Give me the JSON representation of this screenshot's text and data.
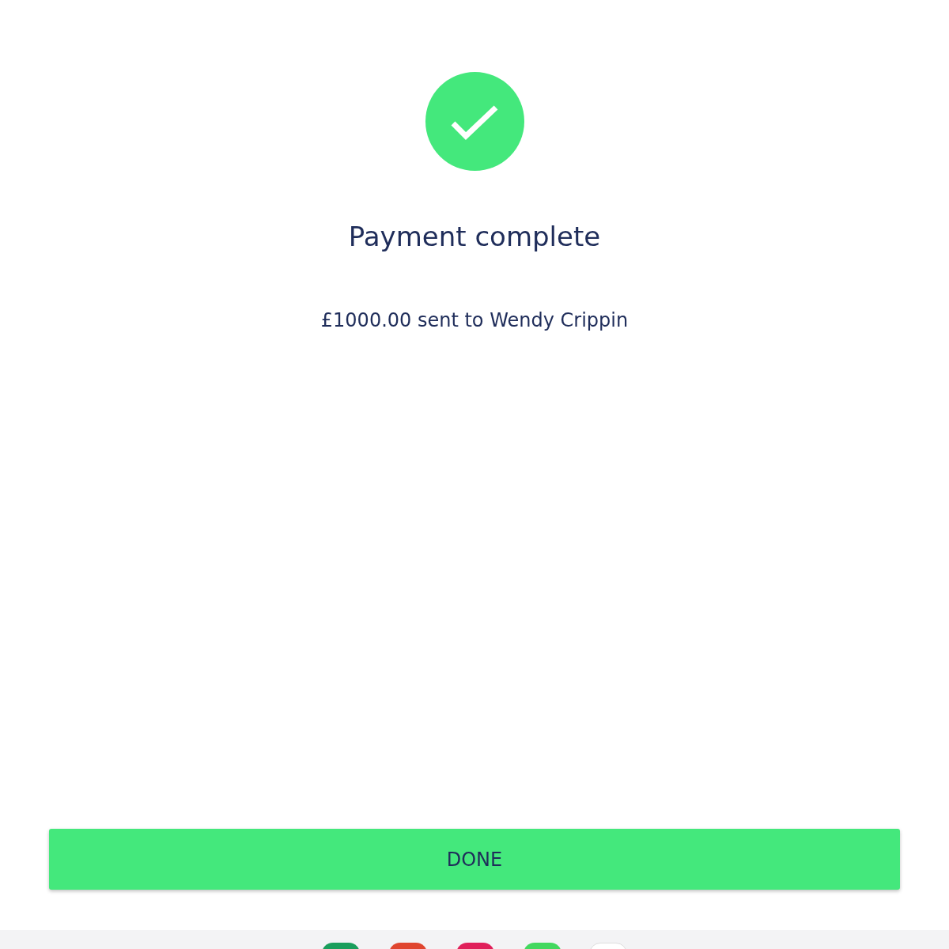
{
  "status": {
    "success": true
  },
  "title": "Payment complete",
  "message": "£1000.00 sent to Wendy Crippin",
  "button": "DONE",
  "dock": {
    "apps": [
      {
        "color": "#1a9e5c"
      },
      {
        "color": "#e0452f"
      },
      {
        "color": "#e01f5a"
      },
      {
        "color": "#43d85f"
      },
      {
        "color": "#ffffff"
      }
    ]
  }
}
